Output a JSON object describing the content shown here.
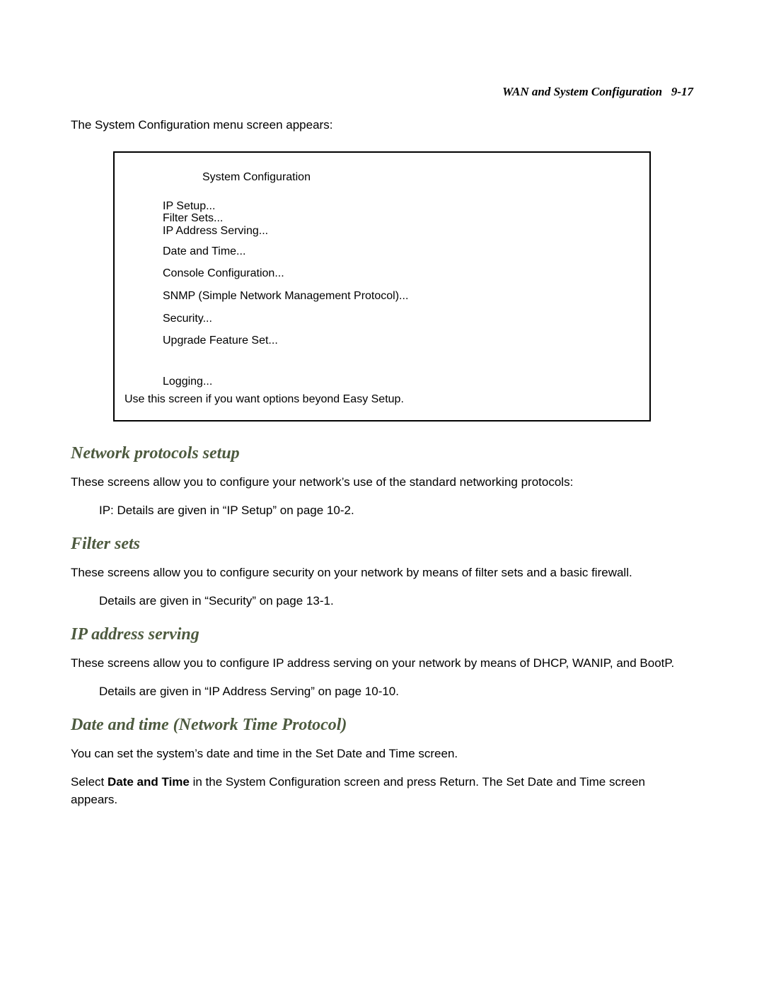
{
  "header": {
    "title": "WAN and System Configuration",
    "page_num": "9-17"
  },
  "intro": "The System Configuration menu screen appears:",
  "screenbox": {
    "title": "System Configuration",
    "group1": {
      "line1": "IP Setup...",
      "line2": "Filter Sets...",
      "line3": "IP Address Serving..."
    },
    "item_date": "Date and Time...",
    "item_console": "Console Configuration...",
    "item_snmp": "SNMP (Simple Network Management Protocol)...",
    "item_security": "Security...",
    "item_upgrade": "Upgrade Feature Set...",
    "item_logging": "Logging...",
    "note": "Use this screen if you want options beyond Easy Setup."
  },
  "sections": {
    "network": {
      "heading": "Network protocols setup",
      "p1": "These screens allow you to configure your network’s use of the standard networking protocols:",
      "p2": "IP: Details are given in “IP Setup” on page 10-2."
    },
    "filter": {
      "heading": "Filter sets",
      "p1": "These screens allow you to configure security on your network by means of filter sets and a basic firewall.",
      "p2": "Details are given in “Security” on page 13-1."
    },
    "ip": {
      "heading": "IP address serving",
      "p1": "These screens allow you to configure IP address serving on your network by means of DHCP, WANIP, and BootP.",
      "p2": "Details are given in “IP Address Serving” on page 10-10."
    },
    "date": {
      "heading": "Date and time (Network Time Protocol)",
      "p1": "You can set the system’s date and time in the Set Date and Time screen.",
      "p2_pre": "Select ",
      "p2_bold": "Date and Time",
      "p2_post": " in the System Configuration screen and press Return. The Set Date and Time screen appears."
    }
  }
}
